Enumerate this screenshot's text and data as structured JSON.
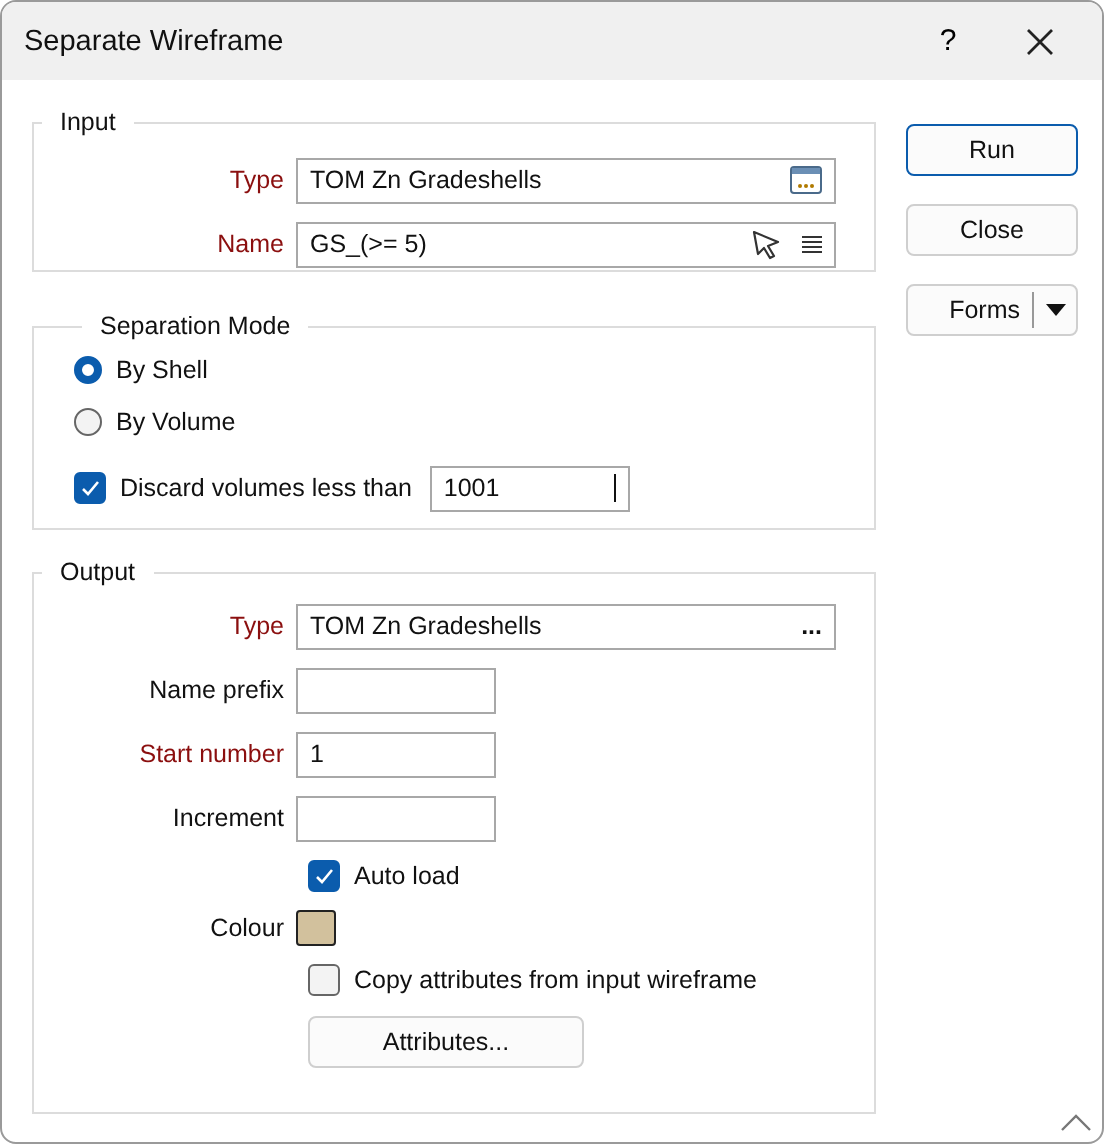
{
  "window": {
    "title": "Separate Wireframe",
    "help": "?"
  },
  "input": {
    "title": "Input",
    "rows": [
      {
        "kind": "field",
        "label": "Type",
        "required": true,
        "value": "TOM Zn Gradeshells",
        "icons": [
          {
            "kind": "browse"
          }
        ]
      },
      {
        "kind": "field",
        "label": "Name",
        "required": true,
        "value": "GS_(>= 5)",
        "icons": [
          {
            "kind": "pick"
          },
          {
            "kind": "list"
          }
        ]
      }
    ]
  },
  "separation_mode": {
    "title": "Separation Mode",
    "options": [
      {
        "label": "By Shell",
        "selected": true
      },
      {
        "label": "By Volume",
        "selected": false
      }
    ],
    "discard": {
      "label": "Discard volumes less than",
      "checked": true,
      "value": "1001"
    }
  },
  "output": {
    "title": "Output",
    "rows": [
      {
        "kind": "path_field",
        "label": "Type",
        "required": true,
        "value": "TOM Zn Gradeshells",
        "browse_text": "..."
      },
      {
        "kind": "field",
        "label": "Name prefix",
        "required": false,
        "value": ""
      },
      {
        "kind": "field",
        "label": "Start number",
        "required": true,
        "value": "1"
      },
      {
        "kind": "field",
        "label": "Increment",
        "required": false,
        "value": ""
      },
      {
        "kind": "checkbox",
        "label": "Auto load",
        "checked": true
      },
      {
        "kind": "colour",
        "label": "Colour",
        "color": "#d2c19d"
      },
      {
        "kind": "checkbox",
        "label": "Copy attributes from input  wireframe",
        "checked": false
      },
      {
        "kind": "button",
        "label": "Attributes..."
      }
    ]
  },
  "buttons": [
    {
      "label": "Run",
      "kind": "default"
    },
    {
      "label": "Close",
      "kind": "plain"
    },
    {
      "label": "Forms",
      "kind": "split"
    }
  ]
}
